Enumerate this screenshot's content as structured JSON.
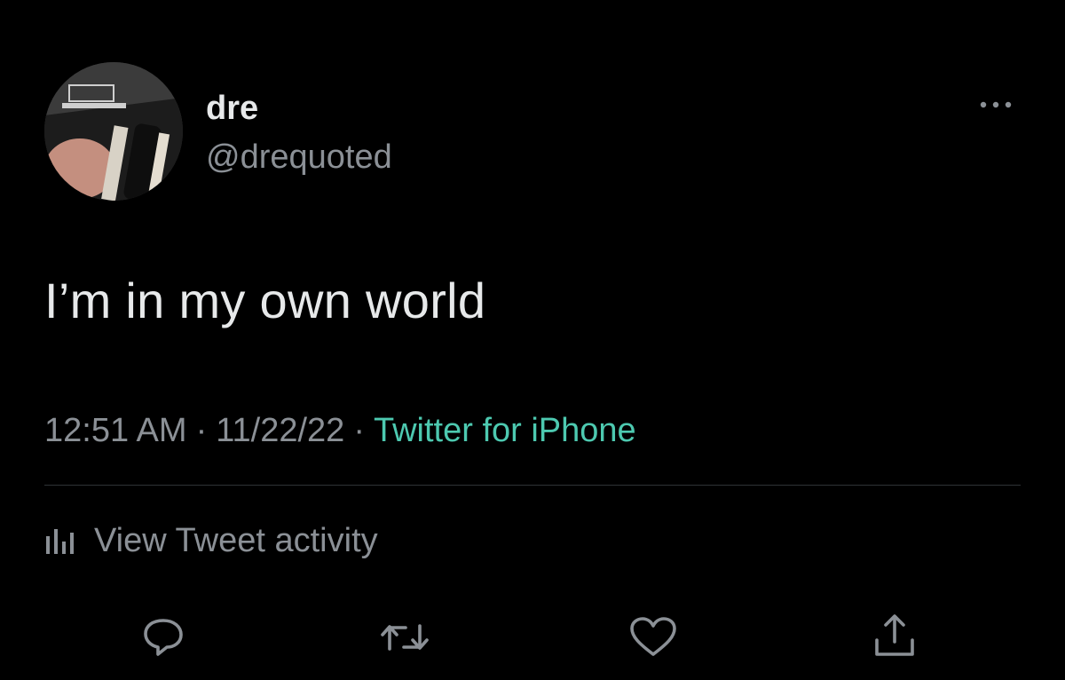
{
  "author": {
    "display_name": "dre",
    "handle": "@drequoted",
    "avatar_icon": "profile-photo"
  },
  "tweet": {
    "text": "I’m in my own world",
    "time": "12:51 AM",
    "date": "11/22/22",
    "separator": "·",
    "source": "Twitter for iPhone"
  },
  "activity": {
    "label": "View Tweet activity",
    "icon": "bar-chart-icon"
  },
  "actions": [
    {
      "name": "reply",
      "icon": "reply-icon"
    },
    {
      "name": "retweet",
      "icon": "retweet-icon"
    },
    {
      "name": "like",
      "icon": "heart-icon"
    },
    {
      "name": "share",
      "icon": "share-icon"
    }
  ],
  "colors": {
    "background": "#000000",
    "primary_text": "#e7e9ea",
    "secondary_text": "#8b9096",
    "link": "#4dc9b0",
    "divider": "#2f3336"
  }
}
